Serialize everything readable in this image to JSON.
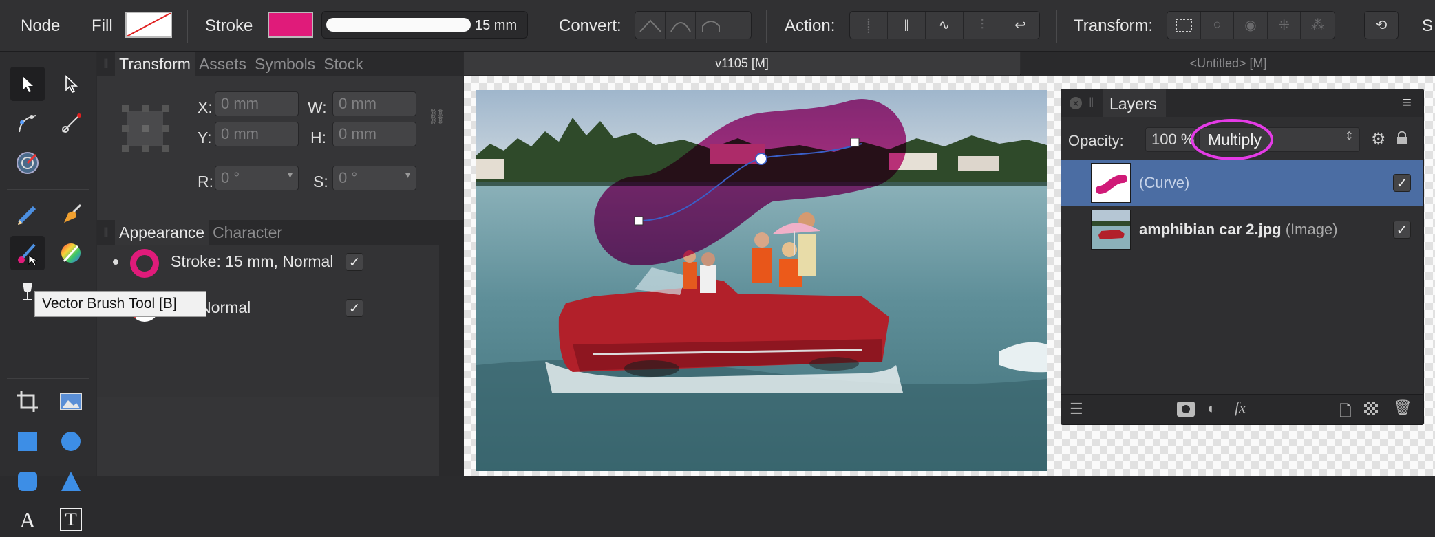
{
  "toolbar": {
    "persona_label": "Node",
    "fill_label": "Fill",
    "stroke_label": "Stroke",
    "stroke_color": "#e01b7a",
    "stroke_width": "15 mm",
    "convert_label": "Convert:",
    "action_label": "Action:",
    "transform_label": "Transform:",
    "snapping_label": "S"
  },
  "tools": {
    "tooltip": "Vector Brush Tool [B]"
  },
  "transform_panel": {
    "tabs": [
      "Transform",
      "Assets",
      "Symbols",
      "Stock"
    ],
    "x_label": "X:",
    "x_value": "0 mm",
    "y_label": "Y:",
    "y_value": "0 mm",
    "w_label": "W:",
    "w_value": "0 mm",
    "h_label": "H:",
    "h_value": "0 mm",
    "r_label": "R:",
    "r_value": "0 °",
    "s_label": "S:",
    "s_value": "0 °"
  },
  "appearance_panel": {
    "tabs": [
      "Appearance",
      "Character"
    ],
    "stroke_item": "Stroke: 15 mm, Normal",
    "fill_item": "Fill: Normal"
  },
  "document_tabs": [
    {
      "label": "v1105  [M]",
      "active": true
    },
    {
      "label": "<Untitled>  [M]",
      "active": false
    }
  ],
  "layers_panel": {
    "title": "Layers",
    "opacity_label": "Opacity:",
    "opacity_value": "100 %",
    "blend_mode": "Multiply",
    "highlight_color": "#e43be6",
    "layers": [
      {
        "name": "(Curve)",
        "type": "",
        "selected": true,
        "visible": true
      },
      {
        "name": "amphibian car 2.jpg",
        "type": "(Image)",
        "selected": false,
        "visible": true
      }
    ]
  },
  "colors": {
    "accent": "#e01b7a",
    "selection": "#4b6da3"
  }
}
